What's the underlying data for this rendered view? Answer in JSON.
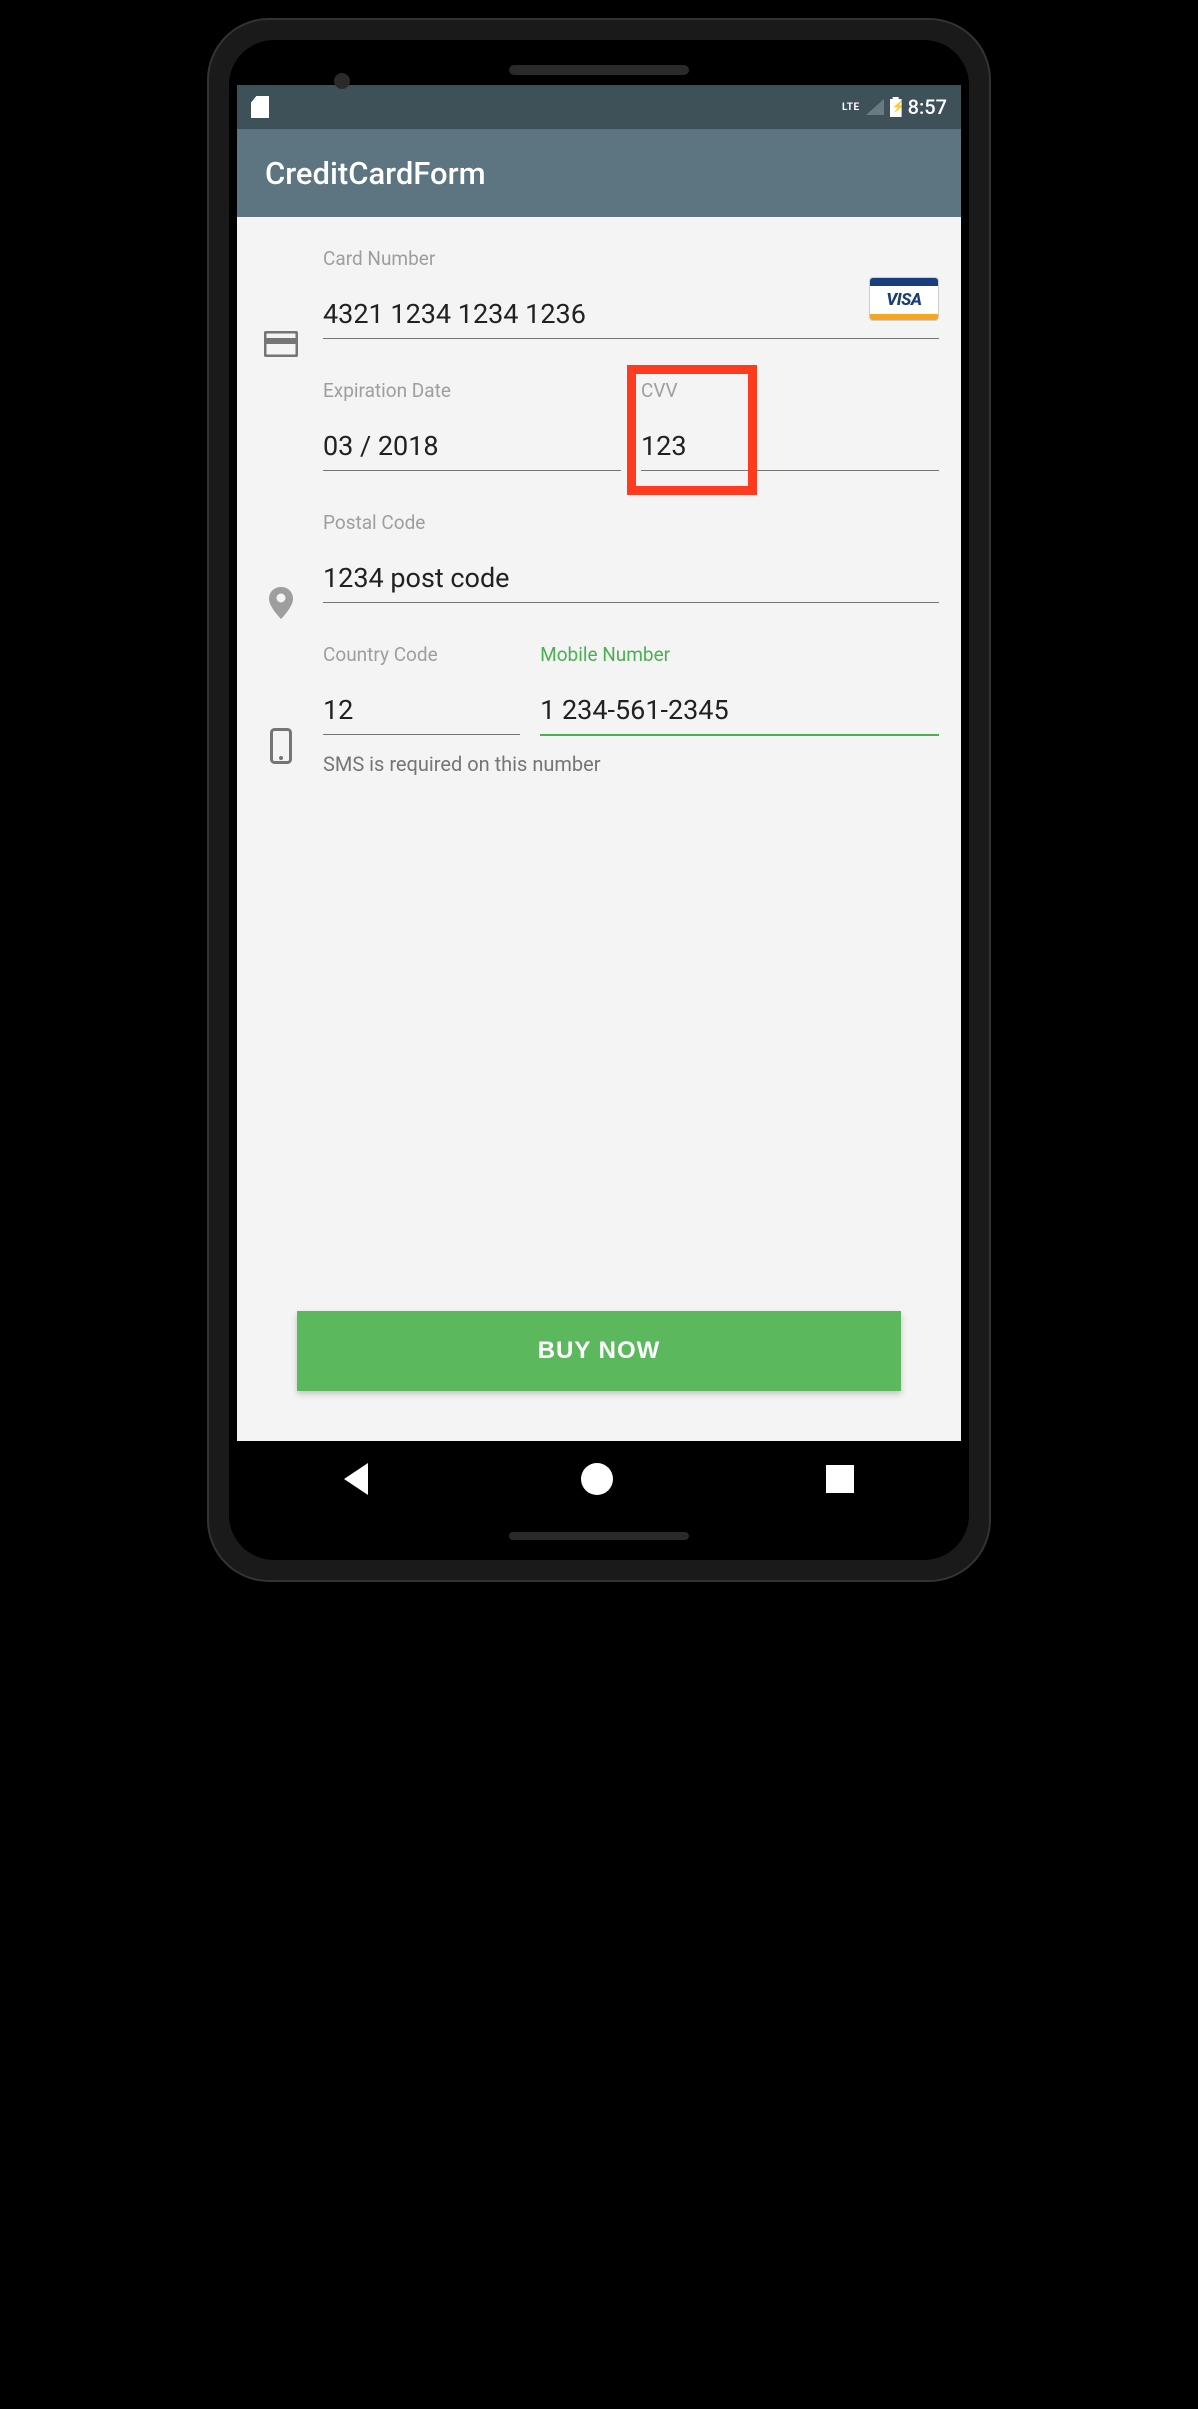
{
  "statusbar": {
    "time": "8:57",
    "network": "LTE"
  },
  "appbar": {
    "title": "CreditCardForm"
  },
  "form": {
    "card_number": {
      "label": "Card Number",
      "value": "4321 1234 1234 1236",
      "brand": "VISA"
    },
    "expiration": {
      "label": "Expiration Date",
      "value": "03 / 2018"
    },
    "cvv": {
      "label": "CVV",
      "value": "123"
    },
    "postal": {
      "label": "Postal Code",
      "value": "1234 post code"
    },
    "country_code": {
      "label": "Country Code",
      "value": "12"
    },
    "mobile": {
      "label": "Mobile Number",
      "value": "1 234-561-2345",
      "helper": "SMS is required on this number"
    }
  },
  "button": {
    "buy": "BUY NOW"
  }
}
